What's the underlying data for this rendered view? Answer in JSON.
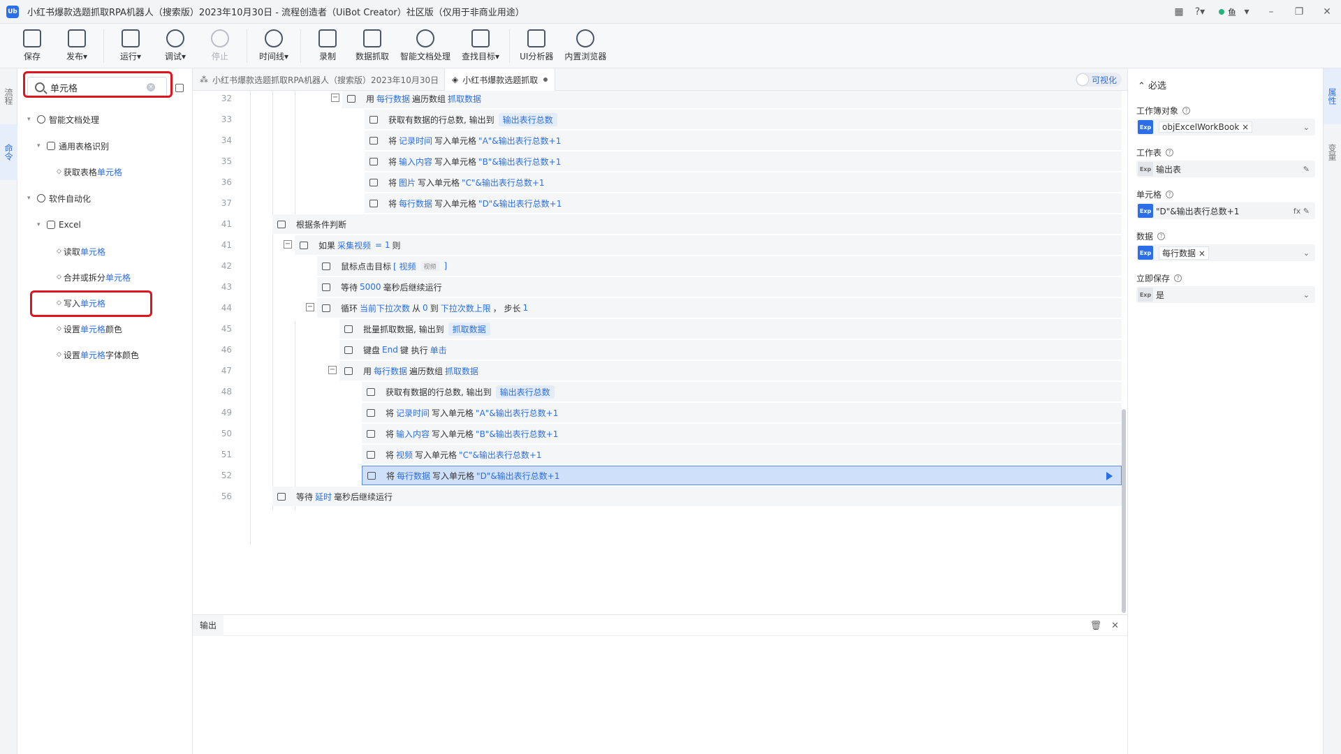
{
  "window": {
    "title": "小红书爆款选题抓取RPA机器人（搜索版）2023年10月30日 - 流程创造者（UiBot Creator）社区版（仅用于非商业用途）",
    "logo": "Ub",
    "user_name": "鱼"
  },
  "toolbar": {
    "items": [
      {
        "label": "保存",
        "icon": "save-icon"
      },
      {
        "label": "发布▾",
        "icon": "send-icon"
      },
      {
        "label": "运行▾",
        "icon": "run-icon"
      },
      {
        "label": "调试▾",
        "icon": "debug-icon"
      },
      {
        "label": "停止",
        "icon": "stop-icon",
        "disabled": true
      },
      {
        "label": "时间线▾",
        "icon": "clock-icon"
      },
      {
        "label": "录制",
        "icon": "record-icon"
      },
      {
        "label": "数据抓取",
        "icon": "data-grab-icon"
      },
      {
        "label": "智能文档处理",
        "icon": "ai-doc-icon"
      },
      {
        "label": "查找目标▾",
        "icon": "find-target-icon"
      },
      {
        "label": "UI分析器",
        "icon": "ui-analyzer-icon"
      },
      {
        "label": "内置浏览器",
        "icon": "browser-icon"
      }
    ]
  },
  "left_strip": {
    "tab1": "流程",
    "tab2": "命令"
  },
  "search": {
    "value": "单元格"
  },
  "tree": {
    "n1": "智能文档处理",
    "n2": "通用表格识别",
    "n3_pre": "获取表格",
    "n3_hl": "单元格",
    "n4": "软件自动化",
    "n5": "Excel",
    "n6_pre": "读取",
    "n6_hl": "单元格",
    "n7_pre": "合并或拆分",
    "n7_hl": "单元格",
    "n8_pre": "写入",
    "n8_hl": "单元格",
    "n9_pre": "设置",
    "n9_hl": "单元格",
    "n9_post": "颜色",
    "n10_pre": "设置",
    "n10_hl": "单元格",
    "n10_post": "字体颜色"
  },
  "tabs": {
    "tab1": "小红书爆款选题抓取RPA机器人（搜索版）2023年10月30日",
    "tab2": "小红书爆款选题抓取",
    "visual_toggle": "可视化"
  },
  "code": {
    "l32": {
      "num": "32",
      "a": "用",
      "b": "每行数据",
      "c": "遍历数组",
      "d": "抓取数据"
    },
    "l33": {
      "num": "33",
      "a": "获取有数据的行总数, 输出到",
      "chip": "输出表行总数"
    },
    "l34": {
      "num": "34",
      "a": "将",
      "b": "记录时间",
      "c": "写入单元格",
      "d": "\"A\"&输出表行总数+1"
    },
    "l35": {
      "num": "35",
      "a": "将",
      "b": "输入内容",
      "c": "写入单元格",
      "d": "\"B\"&输出表行总数+1"
    },
    "l36": {
      "num": "36",
      "a": "将",
      "b": "图片",
      "c": "写入单元格",
      "d": "\"C\"&输出表行总数+1"
    },
    "l37": {
      "num": "37",
      "a": "将",
      "b": "每行数据",
      "c": "写入单元格",
      "d": "\"D\"&输出表行总数+1"
    },
    "l41a": {
      "num": "41",
      "a": "根据条件判断"
    },
    "l41b": {
      "num": "41",
      "a": "如果",
      "b": "采集视频",
      "c": "= 1",
      "d": "则"
    },
    "l42": {
      "num": "42",
      "a": "鼠标点击目标",
      "b": "[ 视频",
      "s": "视频",
      "c": "]"
    },
    "l43": {
      "num": "43",
      "a": "等待",
      "b": "5000",
      "c": "毫秒后继续运行"
    },
    "l44": {
      "num": "44",
      "a": "循环",
      "b": "当前下拉次数",
      "c": "从",
      "d": "0",
      "e": "到",
      "f": "下拉次数上限",
      "g": "， 步长",
      "h": "1"
    },
    "l45": {
      "num": "45",
      "a": "批量抓取数据, 输出到",
      "chip": "抓取数据"
    },
    "l46": {
      "num": "46",
      "a": "键盘",
      "b": "End",
      "c": "键 执行",
      "d": "单击"
    },
    "l47": {
      "num": "47",
      "a": "用",
      "b": "每行数据",
      "c": "遍历数组",
      "d": "抓取数据"
    },
    "l48": {
      "num": "48",
      "a": "获取有数据的行总数, 输出到",
      "chip": "输出表行总数"
    },
    "l49": {
      "num": "49",
      "a": "将",
      "b": "记录时间",
      "c": "写入单元格",
      "d": "\"A\"&输出表行总数+1"
    },
    "l50": {
      "num": "50",
      "a": "将",
      "b": "输入内容",
      "c": "写入单元格",
      "d": "\"B\"&输出表行总数+1"
    },
    "l51": {
      "num": "51",
      "a": "将",
      "b": "视频",
      "c": "写入单元格",
      "d": "\"C\"&输出表行总数+1"
    },
    "l52": {
      "num": "52",
      "a": "将",
      "b": "每行数据",
      "c": "写入单元格",
      "d": "\"D\"&输出表行总数+1"
    },
    "l56": {
      "num": "56",
      "a": "等待",
      "b": "延时",
      "c": "毫秒后继续运行"
    }
  },
  "output": {
    "tab": "输出"
  },
  "props": {
    "section": "必选",
    "workbook_label": "工作簿对象",
    "workbook_value": "objExcelWorkBook",
    "sheet_label": "工作表",
    "sheet_value": "输出表",
    "cell_label": "单元格",
    "cell_value": "\"D\"&输出表行总数+1",
    "data_label": "数据",
    "data_value": "每行数据",
    "save_label": "立即保存",
    "save_value": "是",
    "exp": "Exp",
    "fx": "fx"
  },
  "right_strip": {
    "tab1": "属性",
    "tab2": "变量"
  }
}
